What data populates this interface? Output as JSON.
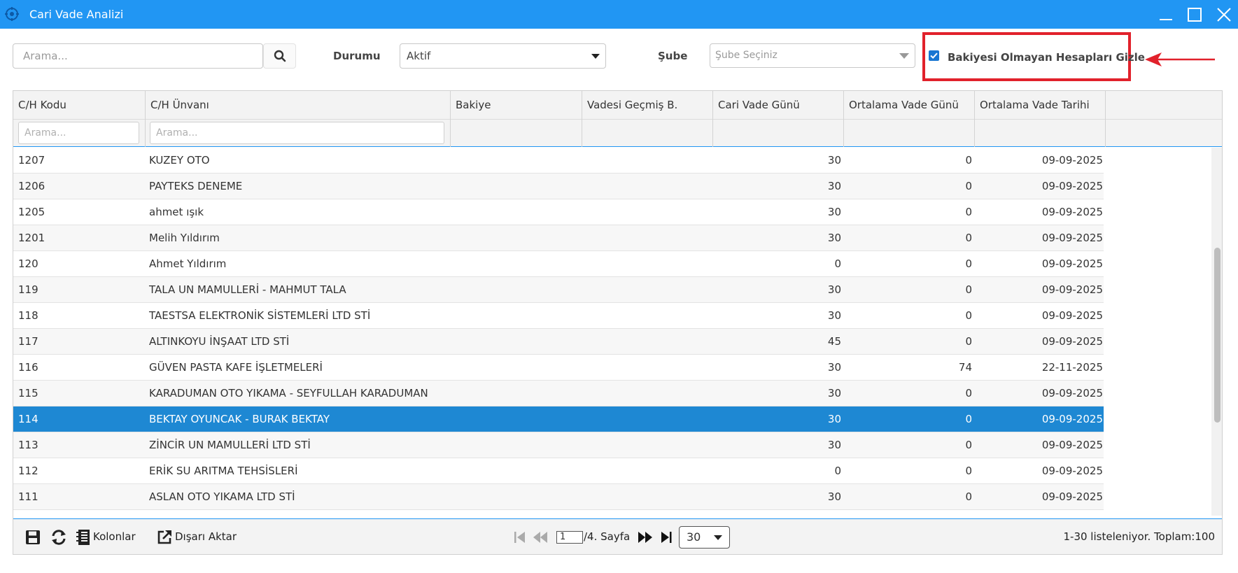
{
  "window": {
    "title": "Cari Vade Analizi"
  },
  "toolbar": {
    "search_placeholder": "Arama...",
    "durum_label": "Durumu",
    "durum_value": "Aktif",
    "sube_label": "Şube",
    "sube_placeholder": "Şube Seçiniz",
    "hide_zero_label": "Bakiyesi Olmayan Hesapları Gizle",
    "hide_zero_checked": true
  },
  "grid": {
    "columns": [
      "C/H Kodu",
      "C/H Ünvanı",
      "Bakiye",
      "Vadesi Geçmiş B.",
      "Cari Vade Günü",
      "Ortalama Vade Günü",
      "Ortalama Vade Tarihi"
    ],
    "filter_placeholder": "Arama...",
    "rows": [
      {
        "kod": "1207",
        "unvan": "KUZEY OTO",
        "bakiye": "",
        "vgb": "",
        "cvg": "30",
        "ovg": "0",
        "ovt": "09-09-2025"
      },
      {
        "kod": "1206",
        "unvan": "PAYTEKS DENEME",
        "bakiye": "",
        "vgb": "",
        "cvg": "30",
        "ovg": "0",
        "ovt": "09-09-2025"
      },
      {
        "kod": "1205",
        "unvan": "ahmet ışık",
        "bakiye": "",
        "vgb": "",
        "cvg": "30",
        "ovg": "0",
        "ovt": "09-09-2025"
      },
      {
        "kod": "1201",
        "unvan": "Melih Yıldırım",
        "bakiye": "",
        "vgb": "",
        "cvg": "30",
        "ovg": "0",
        "ovt": "09-09-2025"
      },
      {
        "kod": "120",
        "unvan": "Ahmet Yıldırım",
        "bakiye": "",
        "vgb": "",
        "cvg": "0",
        "ovg": "0",
        "ovt": "09-09-2025"
      },
      {
        "kod": "119",
        "unvan": "TALA UN MAMULLERİ - MAHMUT TALA",
        "bakiye": "",
        "vgb": "",
        "cvg": "30",
        "ovg": "0",
        "ovt": "09-09-2025"
      },
      {
        "kod": "118",
        "unvan": "TAESTSA ELEKTRONİK SİSTEMLERİ LTD STİ",
        "bakiye": "",
        "vgb": "",
        "cvg": "30",
        "ovg": "0",
        "ovt": "09-09-2025"
      },
      {
        "kod": "117",
        "unvan": "ALTINKOYU İNŞAAT LTD STİ",
        "bakiye": "",
        "vgb": "",
        "cvg": "45",
        "ovg": "0",
        "ovt": "09-09-2025"
      },
      {
        "kod": "116",
        "unvan": "GÜVEN PASTA KAFE İŞLETMELERİ",
        "bakiye": "",
        "vgb": "",
        "cvg": "30",
        "ovg": "74",
        "ovt": "22-11-2025"
      },
      {
        "kod": "115",
        "unvan": "KARADUMAN OTO YIKAMA - SEYFULLAH KARADUMAN",
        "bakiye": "",
        "vgb": "",
        "cvg": "30",
        "ovg": "0",
        "ovt": "09-09-2025"
      },
      {
        "kod": "114",
        "unvan": "BEKTAY OYUNCAK - BURAK BEKTAY",
        "bakiye": "",
        "vgb": "",
        "cvg": "30",
        "ovg": "0",
        "ovt": "09-09-2025",
        "selected": true
      },
      {
        "kod": "113",
        "unvan": "ZİNCİR UN MAMULLERİ LTD STİ",
        "bakiye": "",
        "vgb": "",
        "cvg": "30",
        "ovg": "0",
        "ovt": "09-09-2025"
      },
      {
        "kod": "112",
        "unvan": "ERİK SU ARITMA TEHSİSLERİ",
        "bakiye": "",
        "vgb": "",
        "cvg": "0",
        "ovg": "0",
        "ovt": "09-09-2025"
      },
      {
        "kod": "111",
        "unvan": "ASLAN OTO YIKAMA LTD STİ",
        "bakiye": "",
        "vgb": "",
        "cvg": "30",
        "ovg": "0",
        "ovt": "09-09-2025"
      }
    ]
  },
  "footer": {
    "columns_label": "Kolonlar",
    "export_label": "Dışarı Aktar",
    "page_value": "1",
    "page_suffix": "/4. Sayfa",
    "page_size": "30",
    "summary": "1-30 listeleniyor. Toplam:100"
  },
  "colors": {
    "titlebar": "#2196f3",
    "selected_row": "#1e88d3",
    "highlight": "#e1212b"
  }
}
